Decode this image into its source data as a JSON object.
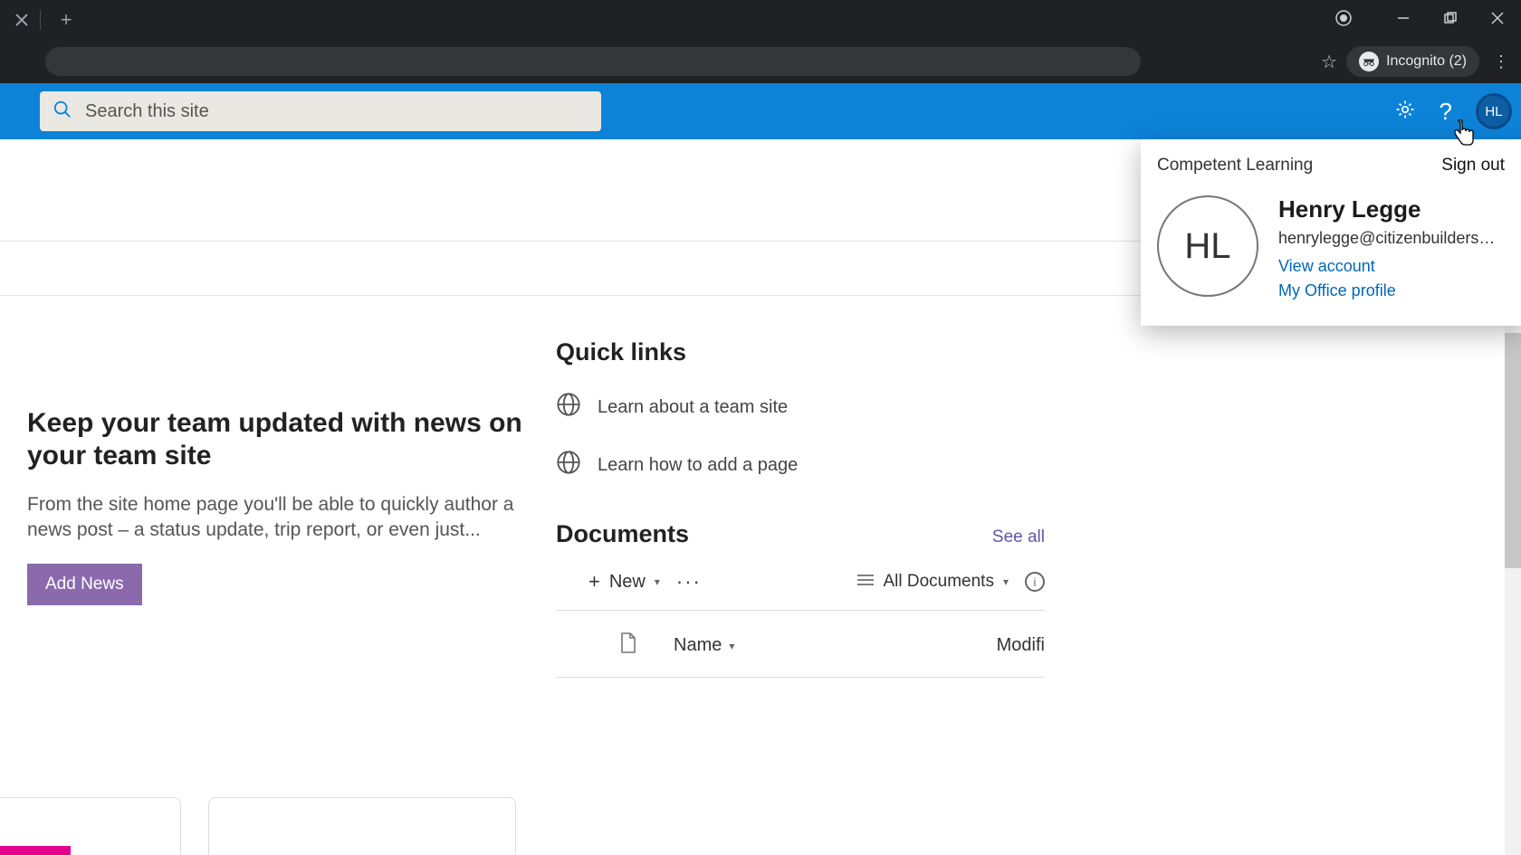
{
  "browser": {
    "incognito_label": "Incognito (2)"
  },
  "topbar": {
    "search_placeholder": "Search this site",
    "avatar_initials": "HL"
  },
  "account_flyout": {
    "org_name": "Competent Learning",
    "signout_label": "Sign out",
    "avatar_initials": "HL",
    "display_name": "Henry Legge",
    "email": "henrylegge@citizenbuilders.o...",
    "view_account_label": "View account",
    "office_profile_label": "My Office profile"
  },
  "news": {
    "title": "Keep your team updated with news on your team site",
    "description": "From the site home page you'll be able to quickly author a news post – a status update, trip report, or even just...",
    "add_news_label": "Add News"
  },
  "quick_links": {
    "heading": "Quick links",
    "items": [
      {
        "label": "Learn about a team site"
      },
      {
        "label": "Learn how to add a page"
      }
    ]
  },
  "documents": {
    "heading": "Documents",
    "see_all_label": "See all",
    "new_label": "New",
    "view_label": "All Documents",
    "columns": {
      "name": "Name",
      "modified": "Modifi"
    }
  }
}
